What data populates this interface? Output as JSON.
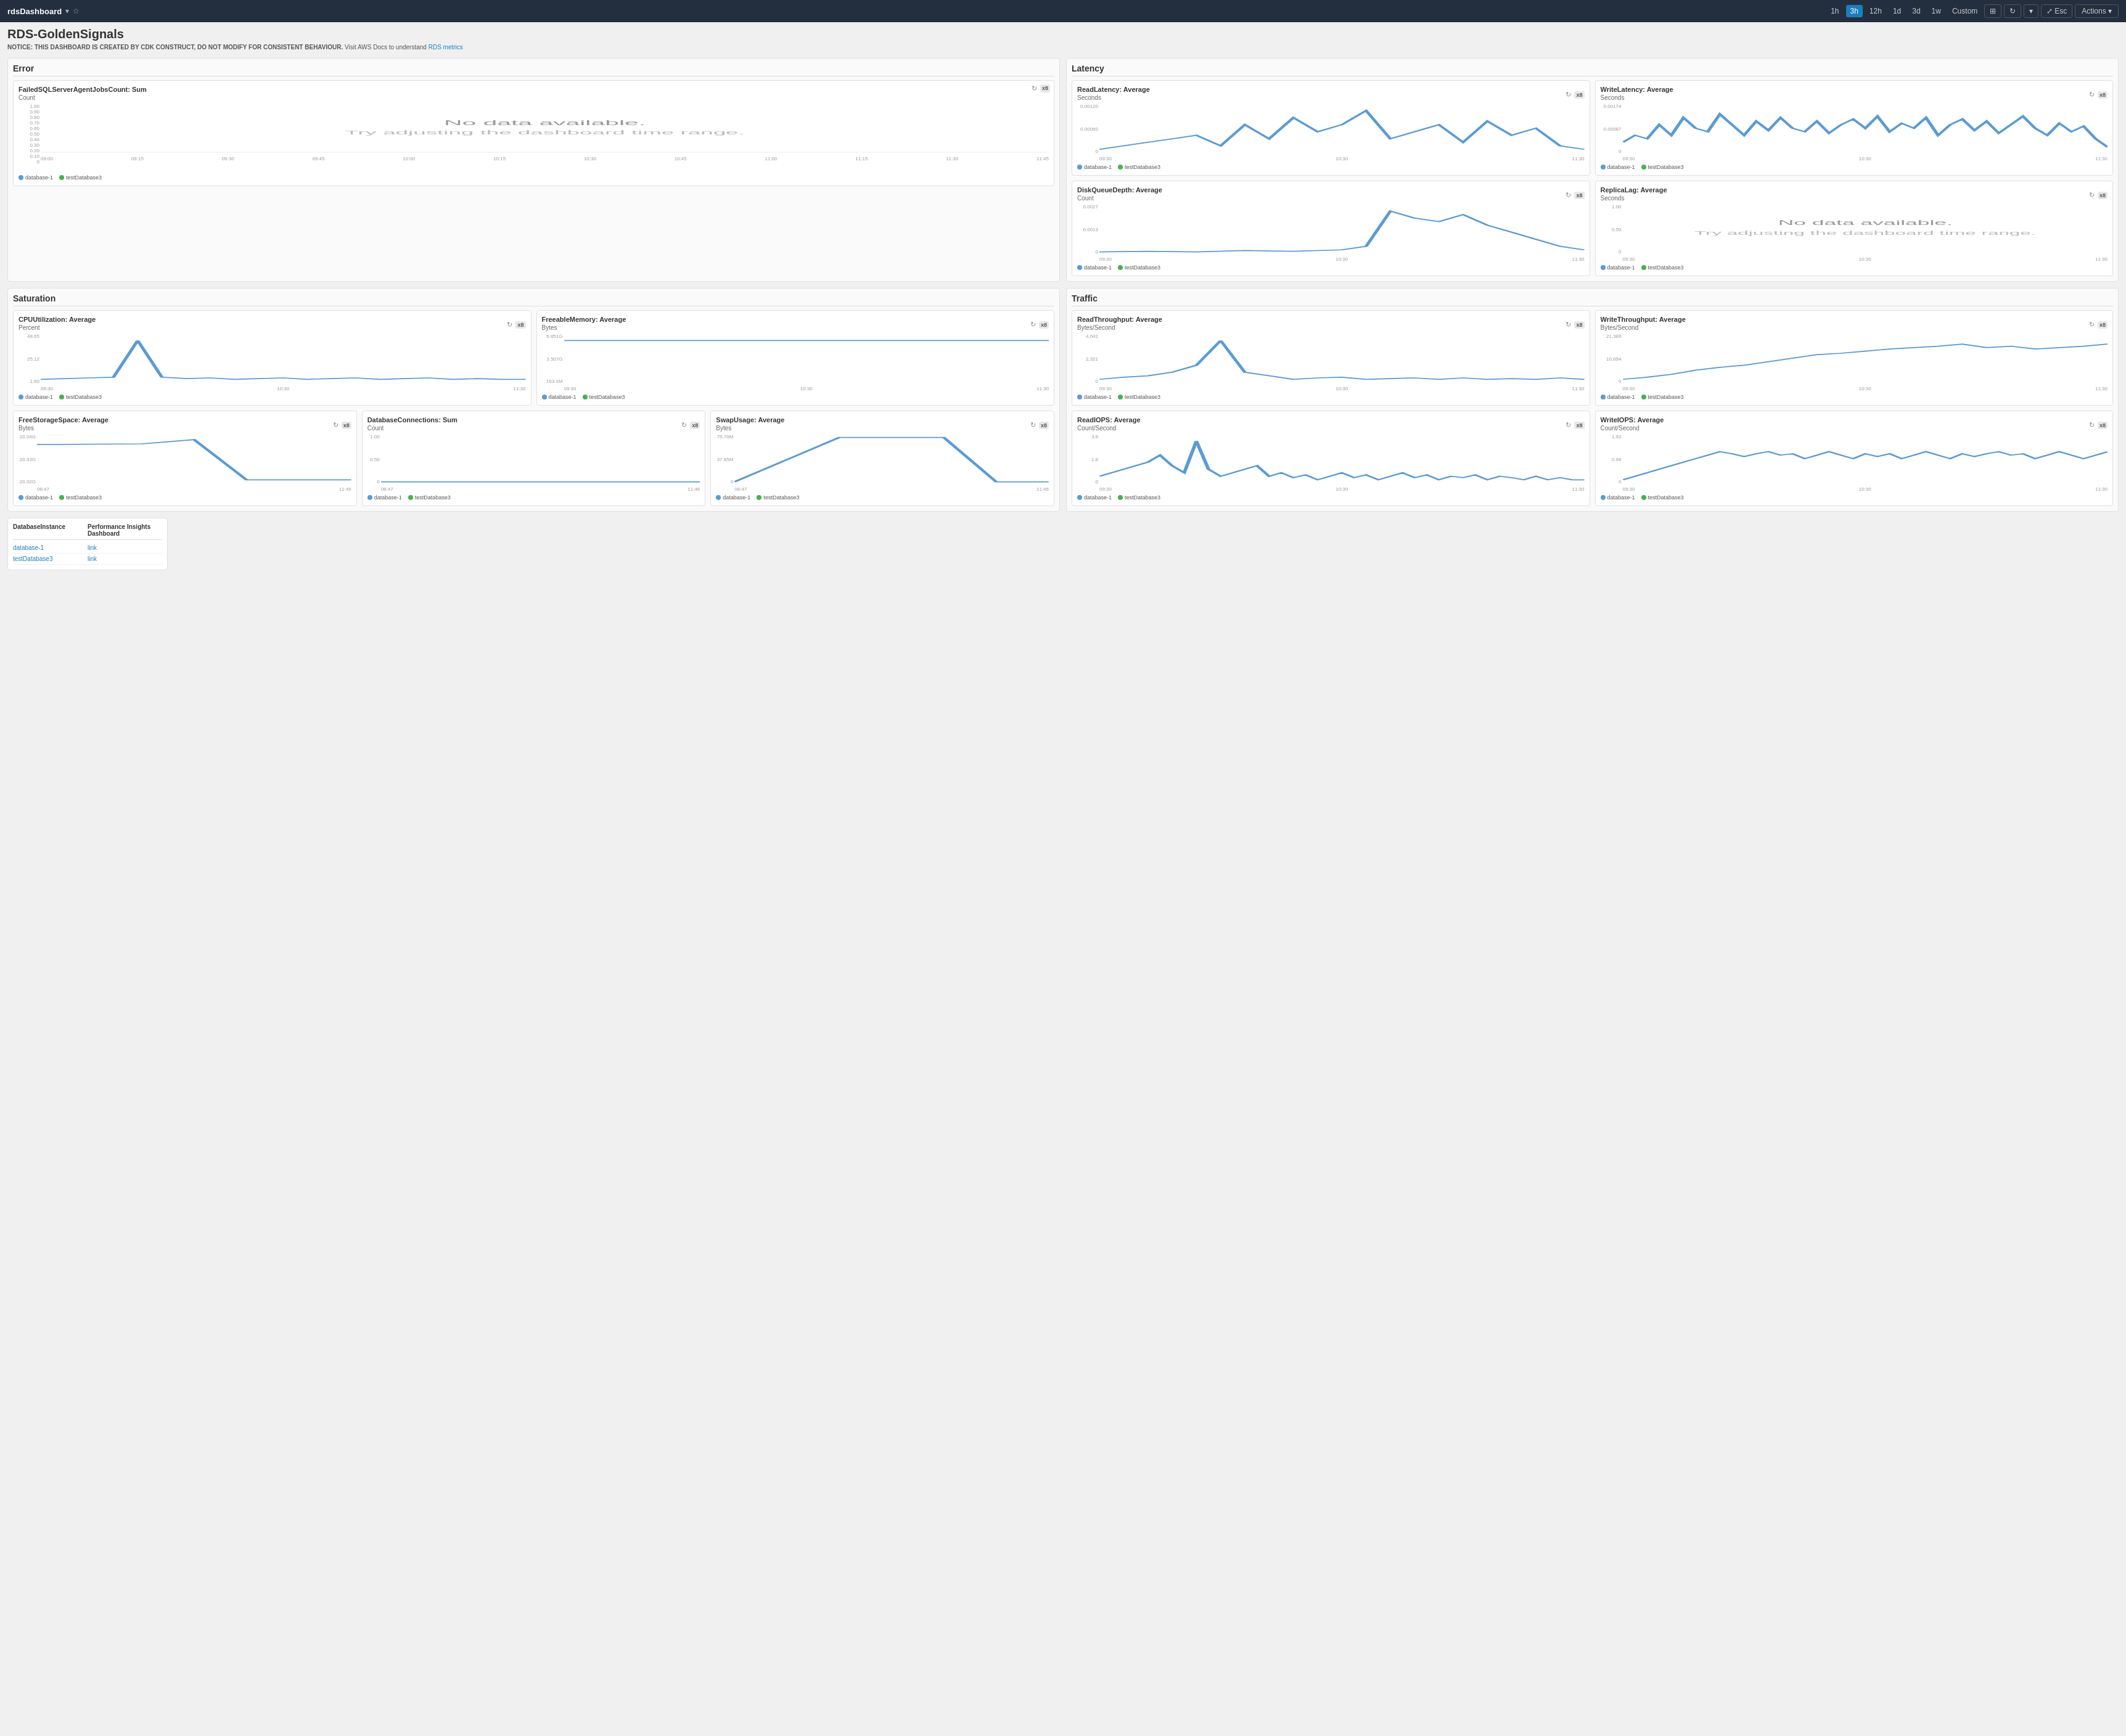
{
  "topbar": {
    "dashboard_name": "rdsDashboard",
    "star_icon": "★",
    "dropdown_icon": "▾",
    "time_options": [
      "1h",
      "3h",
      "12h",
      "1d",
      "3d",
      "1w",
      "Custom"
    ],
    "active_time": "3h",
    "refresh_icon": "↻",
    "dropdown_btn": "▾",
    "fullscreen_label": "Esc",
    "actions_label": "Actions ▾"
  },
  "page": {
    "title": "RDS-GoldenSignals",
    "notice_bold": "NOTICE: THIS DASHBOARD IS CREATED BY CDK CONSTRUCT, DO NOT MODIFY FOR CONSISTENT BEHAVIOUR.",
    "notice_text": " Visit AWS Docs to understand ",
    "notice_link": "RDS metrics"
  },
  "error_section": {
    "label": "Error",
    "chart": {
      "title": "FailedSQLServerAgentJobsCount: Sum",
      "y_label": "Count",
      "y_values": [
        "1.00",
        "0.90",
        "0.80",
        "0.70",
        "0.60",
        "0.50",
        "0.40",
        "0.30",
        "0.20",
        "0.10",
        "0"
      ],
      "x_values": [
        "09:00",
        "09:15",
        "09:30",
        "09:45",
        "10:00",
        "10:15",
        "10:30",
        "10:45",
        "11:00",
        "11:15",
        "11:30",
        "11:45"
      ],
      "no_data": "No data available.",
      "no_data_sub": "Try adjusting the dashboard time range.",
      "legend": [
        {
          "color": "blue",
          "label": "database-1"
        },
        {
          "color": "green",
          "label": "testDatabase3"
        }
      ]
    }
  },
  "latency_section": {
    "label": "Latency",
    "read_latency": {
      "title": "ReadLatency: Average",
      "y_label": "Seconds",
      "y_values": [
        "0.00120",
        "0.00060",
        "0"
      ],
      "x_values": [
        "09:30",
        "10:30",
        "11:30"
      ]
    },
    "write_latency": {
      "title": "WriteLatency: Average",
      "y_label": "Seconds",
      "y_values": [
        "0.00174",
        "0.00087",
        "0"
      ],
      "x_values": [
        "09:30",
        "10:30",
        "11:30"
      ]
    },
    "disk_queue": {
      "title": "DiskQueueDepth: Average",
      "y_label": "Count",
      "y_values": [
        "0.0027",
        "0.0013",
        "0"
      ],
      "x_values": [
        "09:30",
        "10:30",
        "11:30"
      ]
    },
    "replica_lag": {
      "title": "ReplicaLag: Average",
      "y_label": "Seconds",
      "y_values": [
        "1.00",
        "0.50",
        "0"
      ],
      "x_values": [
        "09:30",
        "10:30",
        "11:30"
      ],
      "no_data": "No data available.",
      "no_data_sub": "Try adjusting the dashboard time range."
    },
    "legend": [
      {
        "color": "blue",
        "label": "database-1"
      },
      {
        "color": "green",
        "label": "testDatabase3"
      }
    ]
  },
  "saturation_section": {
    "label": "Saturation",
    "cpu": {
      "title": "CPUUtilization: Average",
      "y_label": "Percent",
      "y_values": [
        "48.65",
        "25.12",
        "1.60"
      ],
      "x_values": [
        "09:30",
        "10:30",
        "11:30"
      ]
    },
    "free_memory": {
      "title": "FreeableMemory: Average",
      "y_label": "Bytes",
      "y_values": [
        "6.851G",
        "3.507G",
        "163.1M"
      ],
      "x_values": [
        "09:30",
        "10:30",
        "11:30"
      ]
    },
    "free_storage": {
      "title": "FreeStorageSpace: Average",
      "y_label": "Bytes",
      "y_values": [
        "20.34G",
        "20.33G",
        "20.32G"
      ],
      "x_values": [
        "08:47",
        "11:46"
      ]
    },
    "db_connections": {
      "title": "DatabaseConnections: Sum",
      "y_label": "Count",
      "y_values": [
        "1.00",
        "0.50",
        "0"
      ],
      "x_values": [
        "08:47",
        "11:46"
      ]
    },
    "swap_usage": {
      "title": "SwapUsage: Average",
      "y_label": "Bytes",
      "y_values": [
        "75.70M",
        "37.85M",
        "0"
      ],
      "x_values": [
        "08:47",
        "11:46"
      ]
    },
    "legend": [
      {
        "color": "blue",
        "label": "database-1"
      },
      {
        "color": "green",
        "label": "testDatabase3"
      }
    ]
  },
  "traffic_section": {
    "label": "Traffic",
    "read_throughput": {
      "title": "ReadThroughput: Average",
      "y_label": "Bytes/Second",
      "y_values": [
        "4,642",
        "2,321",
        "0"
      ],
      "x_values": [
        "09:30",
        "10:30",
        "11:30"
      ]
    },
    "write_throughput": {
      "title": "WriteThroughput: Average",
      "y_label": "Bytes/Second",
      "y_values": [
        "21,389",
        "10,694",
        "0"
      ],
      "x_values": [
        "09:30",
        "10:30",
        "11:30"
      ]
    },
    "read_iops": {
      "title": "ReadIOPS: Average",
      "y_label": "Count/Second",
      "y_values": [
        "3.6",
        "1.8",
        "0"
      ],
      "x_values": [
        "09:30",
        "10:30",
        "11:30"
      ]
    },
    "write_iops": {
      "title": "WriteIOPS: Average",
      "y_label": "Count/Second",
      "y_values": [
        "1.92",
        "0.96",
        "0"
      ],
      "x_values": [
        "09:30",
        "10:30",
        "11:30"
      ]
    },
    "legend": [
      {
        "color": "blue",
        "label": "database-1"
      },
      {
        "color": "green",
        "label": "testDatabase3"
      }
    ]
  },
  "bottom_table": {
    "col1": "DatabaseInstance",
    "col2": "Performance Insights Dashboard",
    "rows": [
      {
        "instance": "database-1",
        "link": "link"
      },
      {
        "instance": "testDatabase3",
        "link": "link"
      }
    ]
  }
}
